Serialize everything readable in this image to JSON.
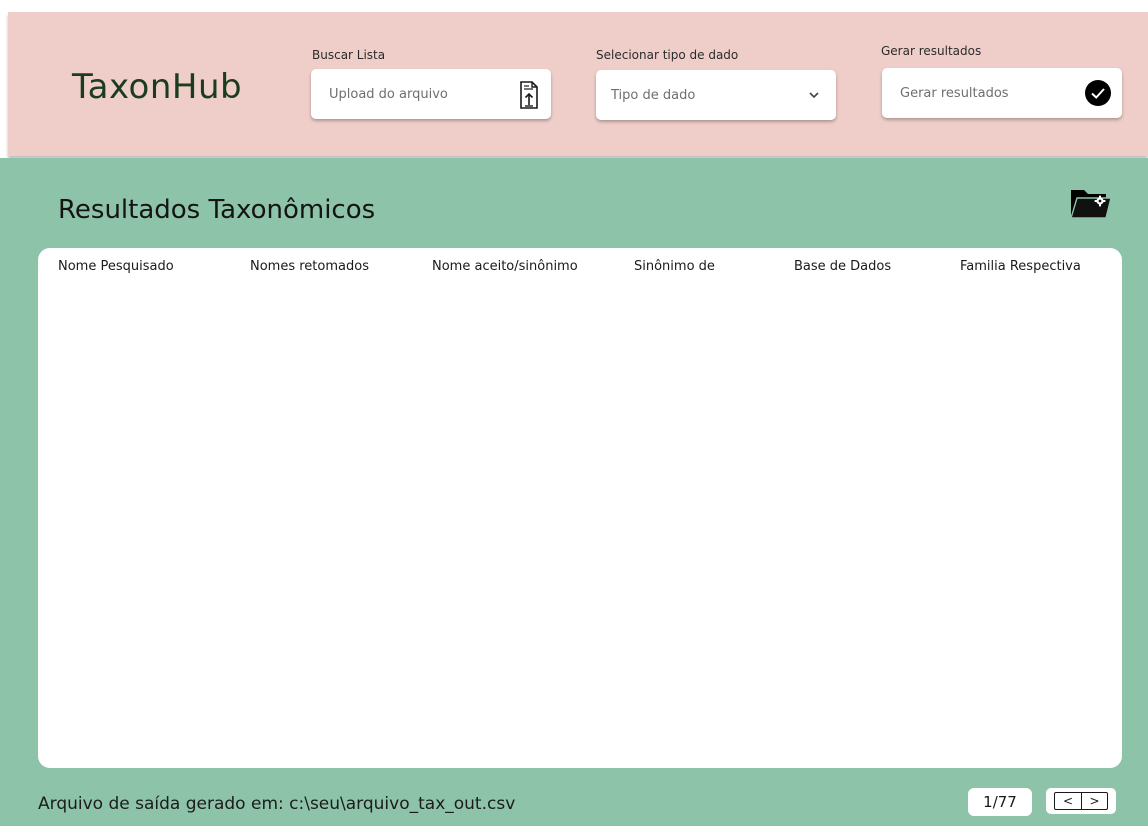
{
  "app": {
    "title": "TaxonHub"
  },
  "header": {
    "upload": {
      "label": "Buscar Lista",
      "placeholder": "Upload do arquivo",
      "icon": "file-upload-icon"
    },
    "data_type": {
      "label": "Selecionar tipo de dado",
      "placeholder": "Tipo de dado",
      "icon": "chevron-down-icon"
    },
    "generate": {
      "label": "Gerar resultados",
      "button_text": "Gerar resultados",
      "icon": "check-circle-icon"
    }
  },
  "main": {
    "title": "Resultados Taxonômicos",
    "folder_icon": "folder-settings-icon",
    "table": {
      "columns": [
        "Nome  Pesquisado",
        "Nomes retomados",
        "Nome aceito/sinônimo",
        "Sinônimo de",
        "Base de Dados",
        "Familia Respectiva"
      ],
      "rows": []
    },
    "footer": {
      "output_text": "Arquivo de saída gerado em: c:\\seu\\arquivo_tax_out.csv",
      "page_indicator": "1/77",
      "prev_label": "<",
      "next_label": ">"
    }
  },
  "colors": {
    "header_bg": "#efcec9",
    "main_bg": "#8dc3a8",
    "logo_text": "#1d3b1f",
    "card_bg": "#ffffff"
  }
}
